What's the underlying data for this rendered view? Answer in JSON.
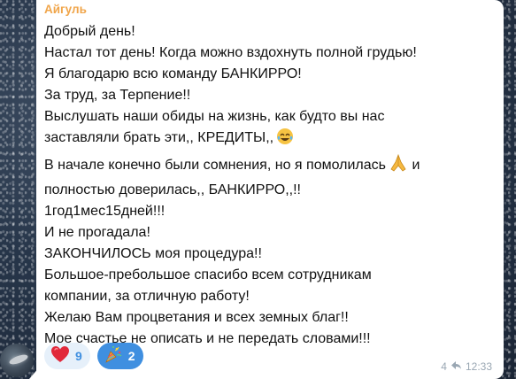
{
  "message": {
    "sender": "Айгуль",
    "lines": [
      "Добрый день!",
      "Настал тот день! Когда можно вздохнуть полной грудью!",
      "Я благодарю всю команду БАНКИРРО!",
      "За труд, за Терпение!!",
      "Выслушать наши обиды на жизнь, как будто вы нас",
      "заставляли брать эти,, КРЕДИТЫ,,",
      "В начале конечно были сомнения, но я помолилась",
      "полностью доверилась,, БАНКИРРО,,!!",
      "1год1мес15дней!!!",
      "И не прогадала!",
      "ЗАКОНЧИЛОСЬ моя процедура!!",
      "Большое-пребольшое спасибо всем сотрудникам",
      "компании, за отличную работу!",
      "Желаю Вам процветания и всех земных благ!!",
      "Мое счастье не описать и не передать словами!!!"
    ],
    "line_7_suffix": "и",
    "reactions": [
      {
        "icon": "heart-icon",
        "count": "9",
        "chosen": false
      },
      {
        "icon": "party-popper-icon",
        "count": "2",
        "chosen": true
      }
    ],
    "forwards": "4",
    "time": "12:33"
  },
  "colors": {
    "sender": "#f0a54a",
    "reaction_bg": "#e6f0fa",
    "reaction_chosen_bg": "#3f8fe0",
    "meta": "#9aa7b3"
  }
}
